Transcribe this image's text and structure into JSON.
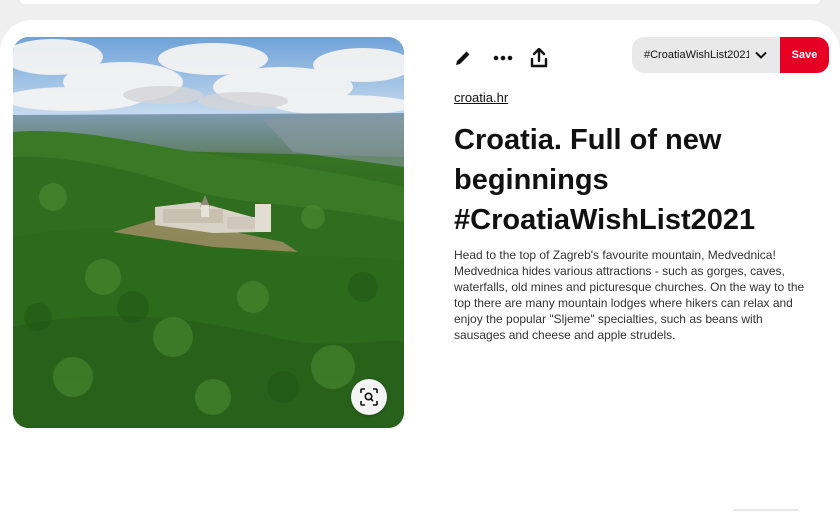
{
  "pin": {
    "source_link": "croatia.hr",
    "title": "Croatia. Full of new beginnings #CroatiaWishList2021",
    "description": "Head to the top of Zagreb's favourite mountain, Medvednica! Medvednica hides various attractions - such as gorges, caves, waterfalls, old mines and picturesque churches. On the way to the top there are many mountain lodges where hikers can relax and enjoy the popular \"Sljeme\" specialties, such as beans with sausages and cheese and apple strudels."
  },
  "toolbar": {
    "board_name": "#CroatiaWishList2021",
    "save_label": "Save"
  },
  "icons": {
    "edit": "pencil-icon",
    "more": "ellipsis-icon",
    "share": "share-icon",
    "board_dropdown": "chevron-down-icon",
    "visual_search": "visual-search-icon"
  },
  "colors": {
    "save_button": "#e60023",
    "board_select_bg": "#e9e9e9",
    "page_bg": "#efefef",
    "text": "#111111"
  }
}
